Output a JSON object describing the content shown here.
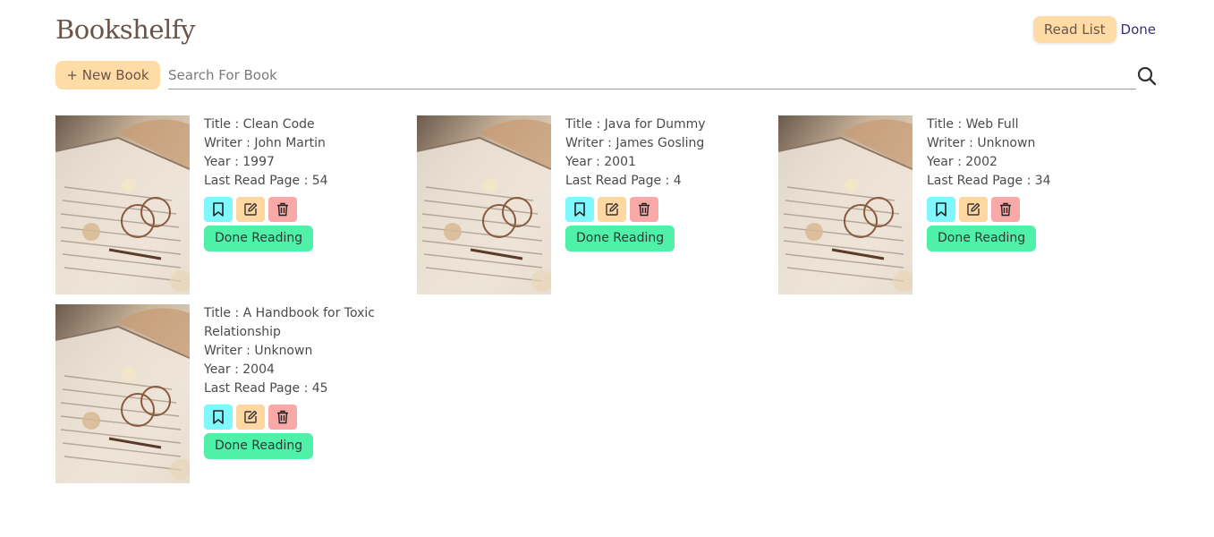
{
  "app": {
    "logo": "Bookshelfy"
  },
  "nav": {
    "read_list": "Read List",
    "done": "Done"
  },
  "toolbar": {
    "new_book": "+ New Book",
    "search_placeholder": "Search For Book"
  },
  "books": [
    {
      "title": "Title : Clean Code",
      "writer": "Writer : John Martin",
      "year": "Year : 1997",
      "last_page": "Last Read Page : 54",
      "done_label": "Done Reading"
    },
    {
      "title": "Title : Java for Dummy",
      "writer": "Writer : James Gosling",
      "year": "Year : 2001",
      "last_page": "Last Read Page : 4",
      "done_label": "Done Reading"
    },
    {
      "title": "Title : Web Full",
      "writer": "Writer : Unknown",
      "year": "Year : 2002",
      "last_page": "Last Read Page : 34",
      "done_label": "Done Reading"
    },
    {
      "title": "Title : A Handbook for Toxic Relationship",
      "writer": "Writer : Unknown",
      "year": "Year : 2004",
      "last_page": "Last Read Page : 45",
      "done_label": "Done Reading"
    }
  ],
  "icons": {
    "bookmark": "bookmark-icon",
    "edit": "edit-icon",
    "delete": "trash-icon",
    "search": "search-icon"
  },
  "colors": {
    "accent": "#ffdca6",
    "bookmark": "#7ef8fc",
    "edit": "#ffd7a1",
    "delete": "#f9a8a8",
    "done": "#4ff0a8",
    "done_nav": "#3d2e74"
  }
}
